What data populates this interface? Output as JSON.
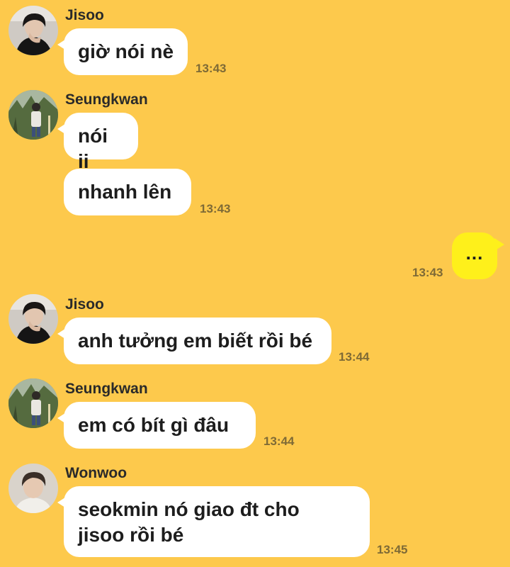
{
  "messages": [
    {
      "sender": "Jisoo",
      "text": "giờ nói nè",
      "time": "13:43"
    },
    {
      "sender": "Seungkwan",
      "text": "nói ii"
    },
    {
      "text": "nhanh lên",
      "time": "13:43"
    },
    {
      "sender": "me",
      "text": "...",
      "time": "13:43"
    },
    {
      "sender": "Jisoo",
      "text": "anh tưởng em biết rồi bé",
      "time": "13:44"
    },
    {
      "sender": "Seungkwan",
      "text": "em có bít gì đâu",
      "time": "13:44"
    },
    {
      "sender": "Wonwoo",
      "text_lines": [
        "seokmin nó giao đt cho",
        "jisoo rồi bé"
      ],
      "time": "13:45"
    }
  ],
  "avatars": {
    "jisoo": "profile-photo-dark",
    "seungkwan": "profile-photo-outdoor",
    "wonwoo": "profile-photo-light"
  },
  "colors": {
    "background": "#fdc94c",
    "incoming_bubble": "#ffffff",
    "outgoing_bubble": "#fef01b",
    "timestamp": "#7e6a36"
  }
}
